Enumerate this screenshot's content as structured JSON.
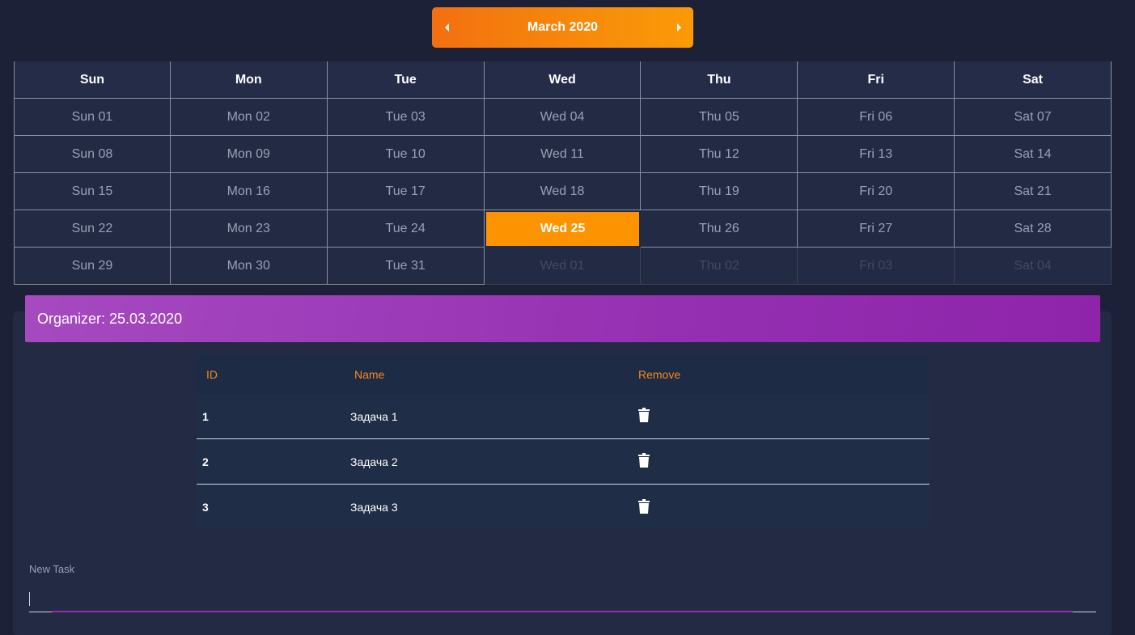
{
  "calendar": {
    "month_label": "March 2020",
    "weekdays": [
      "Sun",
      "Mon",
      "Tue",
      "Wed",
      "Thu",
      "Fri",
      "Sat"
    ],
    "weeks": [
      [
        "Sun 01",
        "Mon 02",
        "Tue 03",
        "Wed 04",
        "Thu 05",
        "Fri 06",
        "Sat 07"
      ],
      [
        "Sun 08",
        "Mon 09",
        "Tue 10",
        "Wed 11",
        "Thu 12",
        "Fri 13",
        "Sat 14"
      ],
      [
        "Sun 15",
        "Mon 16",
        "Tue 17",
        "Wed 18",
        "Thu 19",
        "Fri 20",
        "Sat 21"
      ],
      [
        "Sun 22",
        "Mon 23",
        "Tue 24",
        "Wed 25",
        "Thu 26",
        "Fri 27",
        "Sat 28"
      ],
      [
        "Sun 29",
        "Mon 30",
        "Tue 31",
        "Wed 01",
        "Thu 02",
        "Fri 03",
        "Sat 04"
      ]
    ],
    "selected_day": "Wed 25",
    "next_month_days": [
      "Wed 01",
      "Thu 02",
      "Fri 03",
      "Sat 04"
    ],
    "prev_icon": "caret-left-icon",
    "next_icon": "caret-right-icon"
  },
  "organizer": {
    "title": "Organizer: 25.03.2020",
    "columns": {
      "id": "ID",
      "name": "Name",
      "remove": "Remove"
    },
    "tasks": [
      {
        "id": "1",
        "name": "Задача 1"
      },
      {
        "id": "2",
        "name": "Задача 2"
      },
      {
        "id": "3",
        "name": "Задача 3"
      }
    ],
    "remove_icon": "trash-icon",
    "new_task": {
      "label": "New Task",
      "value": ""
    }
  },
  "colors": {
    "background": "#1c2137",
    "accent_orange": "#fb9400",
    "accent_purple": "#9c27b0",
    "column_header": "#f6891d"
  }
}
